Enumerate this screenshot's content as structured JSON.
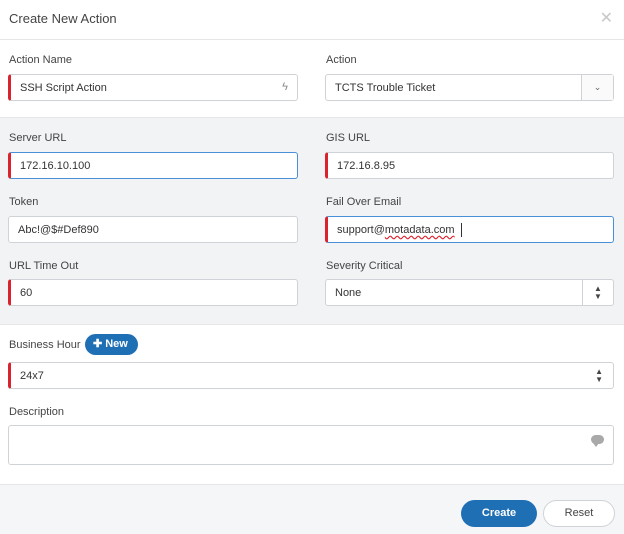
{
  "dialog": {
    "title": "Create New Action",
    "close_icon": "close-icon"
  },
  "form": {
    "action_name": {
      "label": "Action Name",
      "value": "SSH Script Action",
      "icon": "lightning-icon"
    },
    "action": {
      "label": "Action",
      "value": "TCTS Trouble Ticket"
    },
    "server_url": {
      "label": "Server URL",
      "value": "172.16.10.100"
    },
    "gis_url": {
      "label": "GIS URL",
      "value": "172.16.8.95"
    },
    "token": {
      "label": "Token",
      "value": "Abc!@$#Def890"
    },
    "fail_over_email": {
      "label": "Fail Over Email",
      "value_prefix": "support@",
      "value_misspelled": "motadata.com"
    },
    "url_time_out": {
      "label": "URL Time Out",
      "value": "60"
    },
    "severity_critical": {
      "label": "Severity Critical",
      "value": "None"
    },
    "business_hour": {
      "label": "Business Hour",
      "new_label": "New",
      "value": "24x7"
    },
    "description": {
      "label": "Description",
      "value": ""
    }
  },
  "footer": {
    "create_label": "Create",
    "reset_label": "Reset"
  },
  "colors": {
    "required_marker": "#d9232e",
    "primary": "#1f6fb4",
    "section_bg": "#f1f3f5"
  }
}
